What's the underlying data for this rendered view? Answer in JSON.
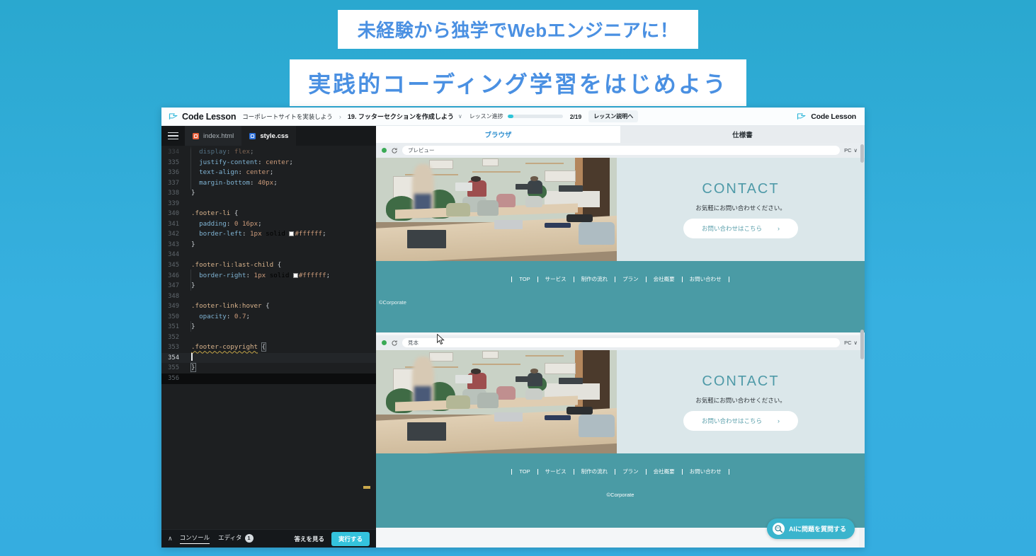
{
  "promo": {
    "headline_line1": "未経験から独学でWebエンジニアに！",
    "headline_line2": "実践的コーディング学習をはじめよう",
    "bg_color": "#2ba9d4",
    "headline_text_color": "#4a90e2"
  },
  "topbar": {
    "logo_text": "Code Lesson",
    "breadcrumb_course": "コーポレートサイトを実装しよう",
    "breadcrumb_separator": "›",
    "lesson_title": "19. フッターセクションを作成しよう",
    "lesson_caret": "∨",
    "progress_label": "レッスン進捗",
    "progress_count": "2/19",
    "progress_percent": 10.5,
    "lesson_desc_button": "レッスン説明へ",
    "right_logo_text": "Code Lesson"
  },
  "editor": {
    "tabs": [
      {
        "label": "index.html",
        "type": "html",
        "active": false
      },
      {
        "label": "style.css",
        "type": "css",
        "active": true
      }
    ],
    "active_file": "style.css",
    "first_visible_line": 334,
    "cursor_line": 354,
    "lines": [
      {
        "n": 334,
        "text": "  display: flex;",
        "clipped": true
      },
      {
        "n": 335,
        "text": "  justify-content: center;"
      },
      {
        "n": 336,
        "text": "  text-align: center;"
      },
      {
        "n": 337,
        "text": "  margin-bottom: 40px;"
      },
      {
        "n": 338,
        "text": "}"
      },
      {
        "n": 339,
        "text": ""
      },
      {
        "n": 340,
        "text": ".footer-li {"
      },
      {
        "n": 341,
        "text": "  padding: 0 16px;"
      },
      {
        "n": 342,
        "text": "  border-left: 1px solid #ffffff;"
      },
      {
        "n": 343,
        "text": "}"
      },
      {
        "n": 344,
        "text": ""
      },
      {
        "n": 345,
        "text": ".footer-li:last-child {"
      },
      {
        "n": 346,
        "text": "  border-right: 1px solid #ffffff;"
      },
      {
        "n": 347,
        "text": "}"
      },
      {
        "n": 348,
        "text": ""
      },
      {
        "n": 349,
        "text": ".footer-link:hover {"
      },
      {
        "n": 350,
        "text": "  opacity: 0.7;"
      },
      {
        "n": 351,
        "text": "}"
      },
      {
        "n": 352,
        "text": ""
      },
      {
        "n": 353,
        "text": ".footer-copyright {"
      },
      {
        "n": 354,
        "text": ""
      },
      {
        "n": 355,
        "text": "}"
      },
      {
        "n": 356,
        "text": ""
      }
    ],
    "footer": {
      "collapse_icon": "∧",
      "tabs": [
        {
          "label": "コンソール",
          "active": true,
          "badge": null
        },
        {
          "label": "エディタ",
          "active": false,
          "badge": "1"
        }
      ],
      "answer_label": "答えを見る",
      "run_label": "実行する",
      "run_color": "#34c3dd"
    }
  },
  "preview": {
    "tabs": [
      {
        "label": "ブラウザ",
        "active": true
      },
      {
        "label": "仕様書",
        "active": false
      }
    ],
    "panels": [
      {
        "name": "preview",
        "address": "プレビュー",
        "device": "PC",
        "status_color": "#3aaa55"
      },
      {
        "name": "sample",
        "address": "見本",
        "device": "PC",
        "status_color": "#3aaa55"
      }
    ],
    "site": {
      "contact_heading": "CONTACT",
      "contact_text": "お気軽にお問い合わせください。",
      "contact_button": "お問い合わせはこちら",
      "contact_button_arrow": "›",
      "heading_color": "#4f9aa8",
      "contact_bg": "#dbe7ea",
      "footer_bg": "#4a9ba5",
      "nav_items": [
        "TOP",
        "サービス",
        "制作の流れ",
        "プラン",
        "会社概要",
        "お問い合わせ"
      ],
      "copyright": "©Corporate"
    },
    "ai_button": {
      "label": "AIに問題を質問する",
      "color": "#3ab4cd"
    }
  }
}
